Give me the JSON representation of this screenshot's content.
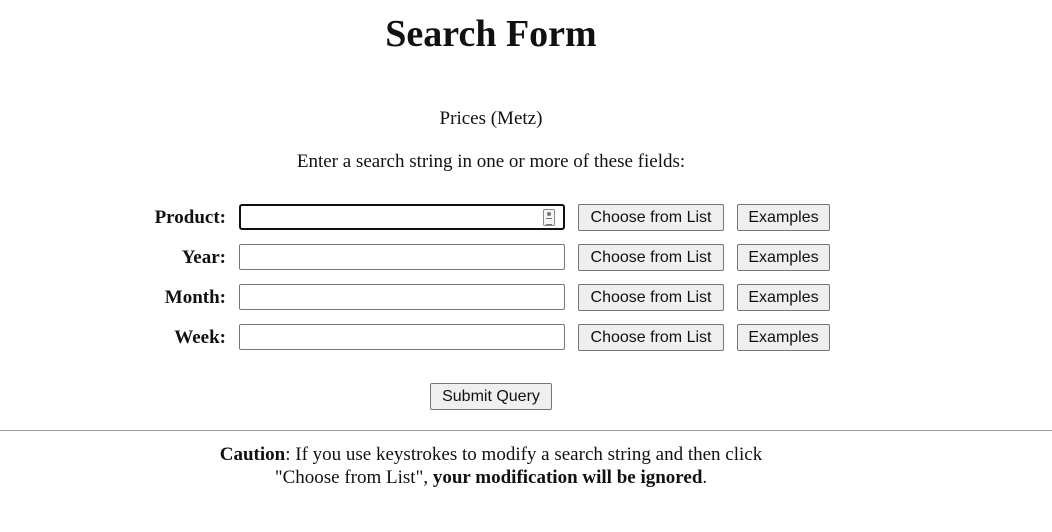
{
  "page": {
    "title": "Search Form",
    "subtitle": "Prices (Metz)",
    "instructions": "Enter a search string in one or more of these fields:"
  },
  "fields": [
    {
      "label": "Product:",
      "value": "",
      "choose_label": "Choose from List",
      "examples_label": "Examples"
    },
    {
      "label": "Year:",
      "value": "",
      "choose_label": "Choose from List",
      "examples_label": "Examples"
    },
    {
      "label": "Month:",
      "value": "",
      "choose_label": "Choose from List",
      "examples_label": "Examples"
    },
    {
      "label": "Week:",
      "value": "",
      "choose_label": "Choose from List",
      "examples_label": "Examples"
    }
  ],
  "submit_label": "Submit Query",
  "caution": {
    "strong_label": "Caution",
    "text_1": ": If you use keystrokes to modify a search string and then click",
    "text_2": "\"Choose from List\", ",
    "strong_end": "your modification will be ignored",
    "text_3": "."
  },
  "icons": {
    "product_field_icon": "contact-card-icon"
  }
}
